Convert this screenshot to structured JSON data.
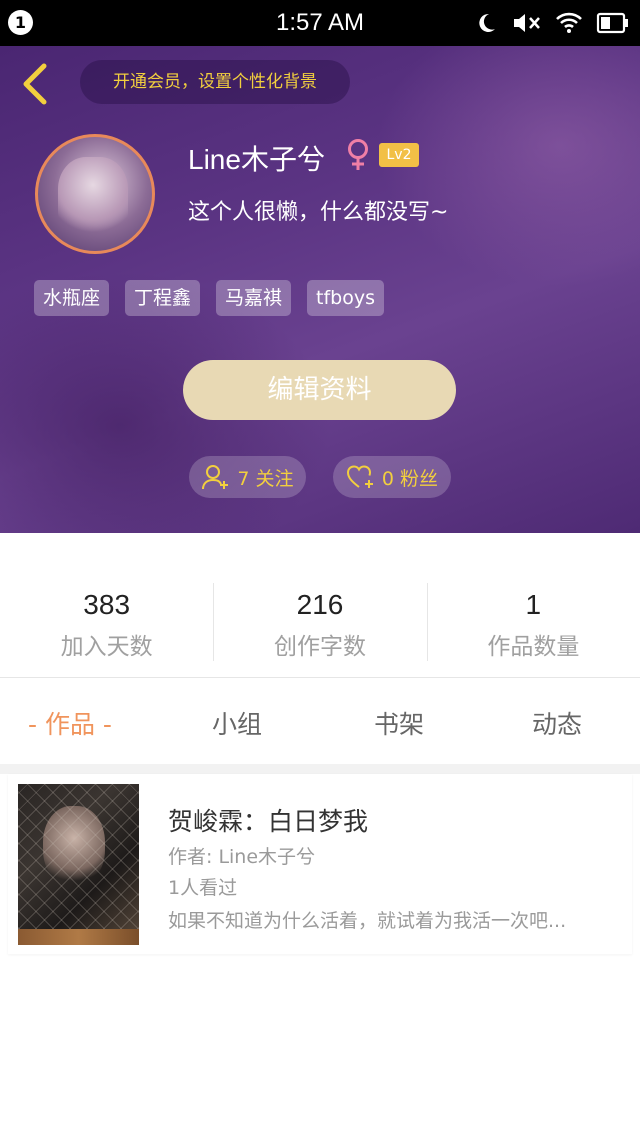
{
  "status_bar": {
    "notification_count": "1",
    "time": "1:57 AM",
    "icons": [
      "moon-icon",
      "mute-icon",
      "wifi-icon",
      "battery-icon"
    ]
  },
  "header": {
    "vip_prompt": "开通会员，设置个性化背景",
    "username": "Line木子兮",
    "gender_symbol": "♀",
    "level": "Lv2",
    "bio": "这个人很懒，什么都没写~",
    "tags": [
      "水瓶座",
      "丁程鑫",
      "马嘉祺",
      "tfboys"
    ],
    "edit_profile_label": "编辑资料",
    "following_label": "7 关注",
    "fans_label": "0 粉丝"
  },
  "stats": [
    {
      "value": "383",
      "label": "加入天数"
    },
    {
      "value": "216",
      "label": "创作字数"
    },
    {
      "value": "1",
      "label": "作品数量"
    }
  ],
  "tabs": [
    {
      "label": "- 作品 -",
      "active": true
    },
    {
      "label": "小组",
      "active": false
    },
    {
      "label": "书架",
      "active": false
    },
    {
      "label": "动态",
      "active": false
    }
  ],
  "works": [
    {
      "title": "贺峻霖：白日梦我",
      "author": "作者: Line木子兮",
      "views": "1人看过",
      "description": "如果不知道为什么活着，就试着为我活一次吧..."
    }
  ],
  "colors": {
    "accent_orange": "#f0945c",
    "gold": "#f2cf3e",
    "header_purple": "#5b3483",
    "edit_button": "#e8d9b4",
    "level_badge": "#f2c046"
  }
}
